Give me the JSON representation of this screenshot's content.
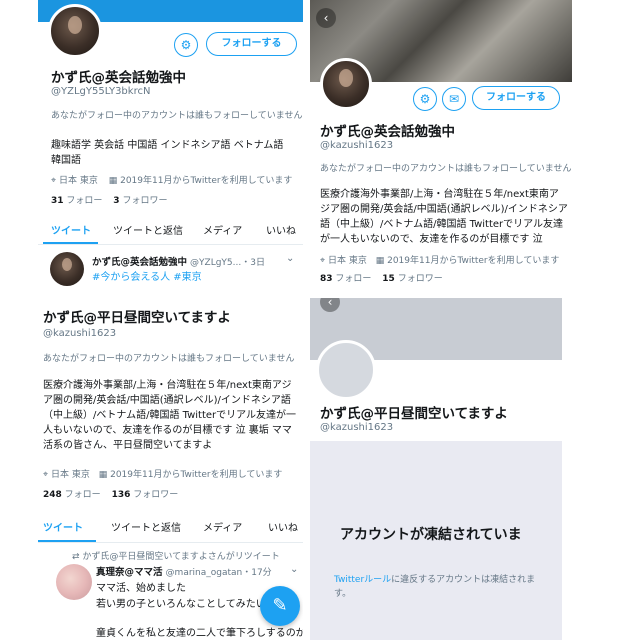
{
  "colors": {
    "accent": "#1da1f2",
    "header_blue": "#1b95e0",
    "suspended_bg": "#e9eaf2"
  },
  "panel1": {
    "name": "かず氏@英会話勉強中",
    "handle": "@YZLgY55LY3bkrcN",
    "no_mutual": "あなたがフォロー中のアカウントは誰もフォローしていません",
    "bio": "趣味語学 英会話 中国語 インドネシア語 ベトナム語 韓国語",
    "location": "日本 東京",
    "joined": "2019年11月からTwitterを利用しています",
    "following_count": "31",
    "following_label": "フォロー",
    "followers_count": "3",
    "followers_label": "フォロワー",
    "follow_button": "フォローする",
    "tabs": [
      "ツイート",
      "ツイートと返信",
      "メディア",
      "いいね"
    ],
    "tweet": {
      "author": "かず氏@英会話勉強中",
      "meta": "@YZLgY5...・3日",
      "hashtags": "#今から会える人 #東京"
    }
  },
  "panel2": {
    "name": "かず氏@英会話勉強中",
    "handle": "@kazushi1623",
    "no_mutual": "あなたがフォロー中のアカウントは誰もフォローしていません",
    "bio": "医療介護海外事業部/上海・台湾駐在５年/next東南アジア圏の開発/英会話/中国語(通訳レベル)/インドネシア語（中上級）/ベトナム語/韓国語 Twitterでリアル友達が一人もいないので、友達を作るのが目標です 泣",
    "location": "日本 東京",
    "joined": "2019年11月からTwitterを利用しています",
    "following_count": "83",
    "following_label": "フォロー",
    "followers_count": "15",
    "followers_label": "フォロワー",
    "follow_button": "フォローする"
  },
  "panel3": {
    "name": "かず氏@平日昼間空いてますよ",
    "handle": "@kazushi1623",
    "no_mutual": "あなたがフォロー中のアカウントは誰もフォローしていません",
    "bio": "医療介護海外事業部/上海・台湾駐在５年/next東南アジア圏の開発/英会話/中国語(通訳レベル)/インドネシア語（中上級）/ベトナム語/韓国語 Twitterでリアル友達が一人もいないので、友達を作るのが目標です 泣 裏垢 ママ活系の皆さん、平日昼間空いてますよ",
    "location": "日本 東京",
    "joined": "2019年11月からTwitterを利用しています",
    "following_count": "248",
    "following_label": "フォロー",
    "followers_count": "136",
    "followers_label": "フォロワー",
    "tabs": [
      "ツイート",
      "ツイートと返信",
      "メディア",
      "いいね"
    ],
    "retweet_note": "かず氏@平日昼間空いてますよさんがリツイート",
    "tweet": {
      "author": "真理奈@ママ活",
      "meta": "@marina_ogatan・17分",
      "line1": "ママ活、始めました",
      "line2": "若い男の子といろんなことしてみたい",
      "line3": "童貞くんを私と友達の二人で筆下ろしするのが最"
    }
  },
  "panel4": {
    "name": "かず氏@平日昼間空いてますよ",
    "handle": "@kazushi1623",
    "suspended_title": "アカウントが凍結されていま",
    "suspended_link": "Twitterルール",
    "suspended_text": "に違反するアカウントは凍結されます。"
  }
}
